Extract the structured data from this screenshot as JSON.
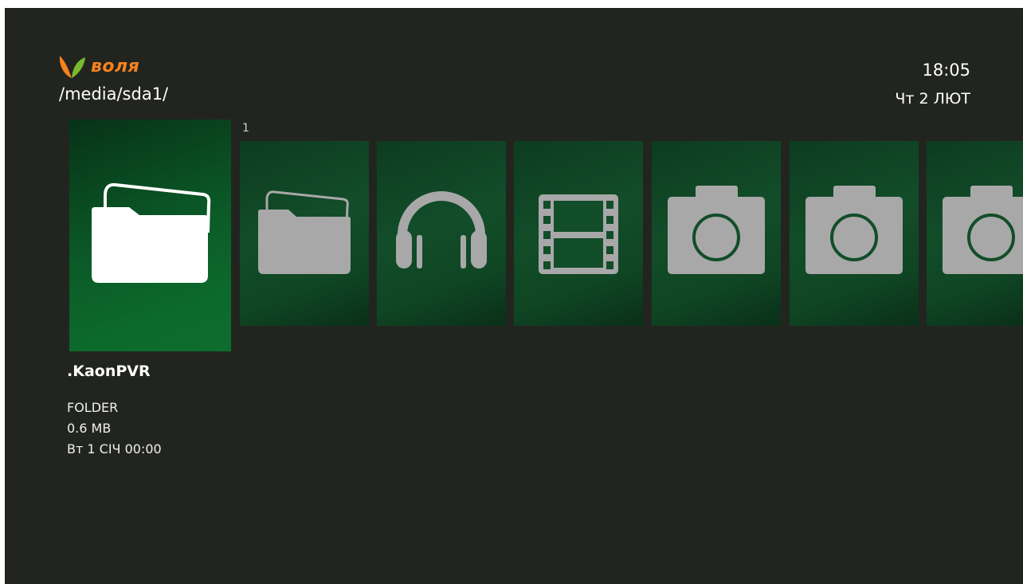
{
  "brand": {
    "name": "воля",
    "leaf_colors": [
      "#f5821f",
      "#7ab929"
    ]
  },
  "header": {
    "path": "/media/sda1/",
    "time": "18:05",
    "date": "Чт 2 ЛЮТ"
  },
  "carousel": {
    "page_number": "1",
    "items": [
      {
        "icon": "folder-open-icon",
        "selected": true
      },
      {
        "icon": "folder-icon"
      },
      {
        "icon": "headphones-icon"
      },
      {
        "icon": "film-icon"
      },
      {
        "icon": "camera-icon"
      },
      {
        "icon": "camera-icon"
      },
      {
        "icon": "camera-icon"
      }
    ]
  },
  "selected_item": {
    "name": ".KaonPVR",
    "type": "FOLDER",
    "size": "0.6 MB",
    "modified": "Вт 1 СІЧ 00:00"
  },
  "colors": {
    "background": "#22251f",
    "tile": "#124d29",
    "tile_selected": "#0c6a2c",
    "icon": "#a8a8a8",
    "icon_selected": "#ffffff",
    "accent": "#f5821f"
  }
}
